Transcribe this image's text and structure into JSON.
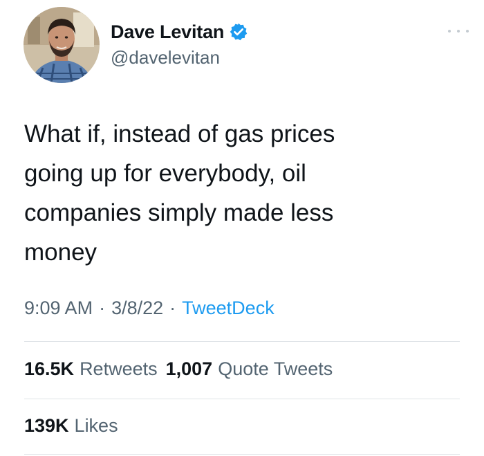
{
  "author": {
    "display_name": "Dave Levitan",
    "handle": "@davelevitan",
    "verified": true,
    "avatar": "profile-photo"
  },
  "tweet": {
    "text": "What if, instead of gas prices\ngoing up for everybody, oil\ncompanies simply made less\nmoney",
    "time": "9:09 AM",
    "date": "3/8/22",
    "separator": "·",
    "source": "TweetDeck"
  },
  "stats": {
    "retweets_count": "16.5K",
    "retweets_label": "Retweets",
    "quote_tweets_count": "1,007",
    "quote_tweets_label": "Quote Tweets",
    "likes_count": "139K",
    "likes_label": "Likes"
  },
  "colors": {
    "link": "#1d9bf0",
    "secondary_text": "#536471",
    "primary_text": "#0f1419",
    "verified_badge": "#1d9bf0"
  }
}
